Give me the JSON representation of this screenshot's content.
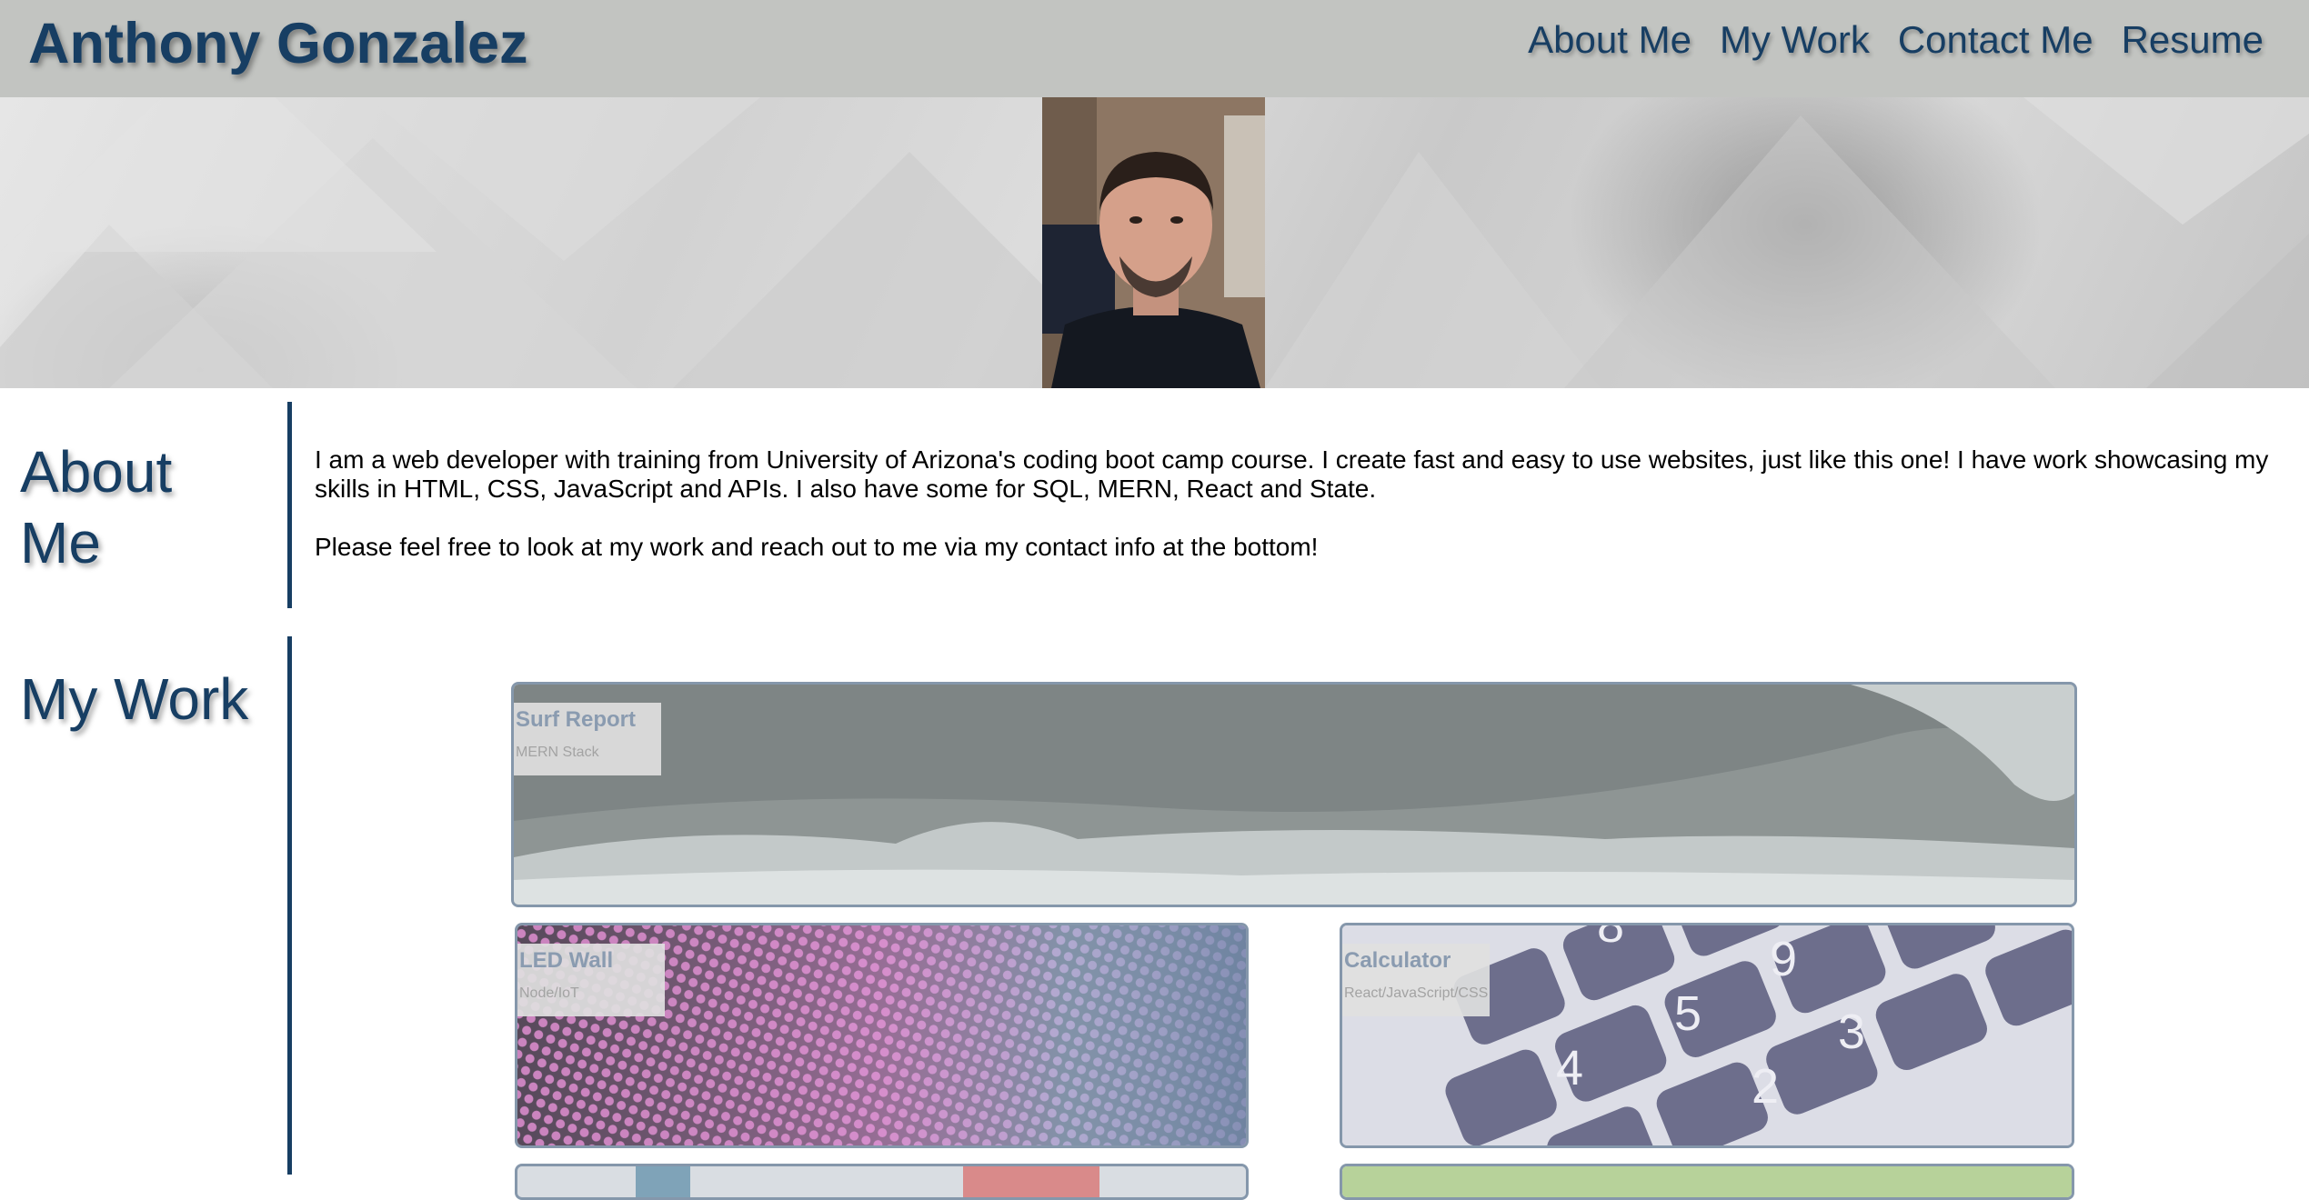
{
  "header": {
    "title": "Anthony Gonzalez",
    "nav": [
      "About Me",
      "My Work",
      "Contact Me",
      "Resume"
    ]
  },
  "hero": {
    "photo_icon": "profile-photo"
  },
  "about": {
    "heading": "About Me",
    "paragraphs": [
      "I am a web developer with training from University of Arizona's coding boot camp course. I create fast and easy to use websites, just like this one! I have work showcasing my skills in HTML, CSS, JavaScript and APIs. I also have some for SQL, MERN, React and State.",
      "Please feel free to look at my work and reach out to me via my contact info at the bottom!"
    ]
  },
  "work": {
    "heading": "My Work",
    "projects": [
      {
        "name": "Surf Report",
        "stack": "MERN Stack"
      },
      {
        "name": "LED Wall",
        "stack": "Node/IoT"
      },
      {
        "name": "Calculator",
        "stack": "React/JavaScript/CSS"
      }
    ]
  },
  "colors": {
    "header_bg": "#c2c4c1",
    "accent": "#173e63",
    "card_border": "#8597ab"
  }
}
